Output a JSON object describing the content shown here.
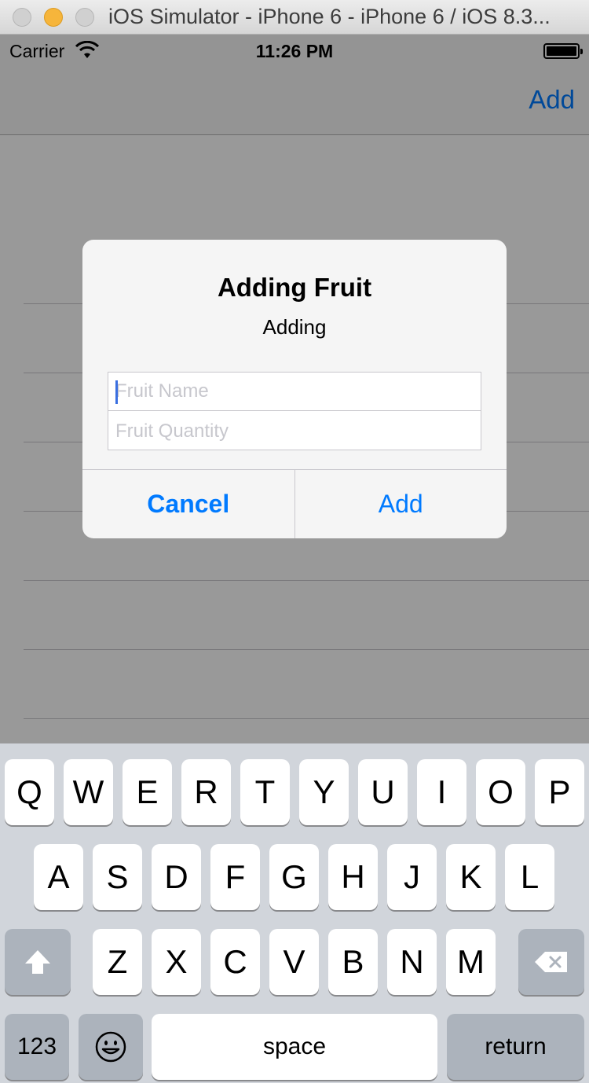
{
  "window": {
    "title": "iOS Simulator - iPhone 6 - iPhone 6 / iOS 8.3..."
  },
  "status_bar": {
    "carrier": "Carrier",
    "time": "11:26 PM",
    "wifi_icon": "wifi-icon",
    "battery_icon": "battery-icon"
  },
  "nav_bar": {
    "add_label": "Add"
  },
  "alert": {
    "title": "Adding Fruit",
    "message": "Adding",
    "fields": [
      {
        "placeholder": "Fruit Name",
        "value": ""
      },
      {
        "placeholder": "Fruit Quantity",
        "value": ""
      }
    ],
    "cancel_label": "Cancel",
    "add_label": "Add"
  },
  "keyboard": {
    "row1": [
      "Q",
      "W",
      "E",
      "R",
      "T",
      "Y",
      "U",
      "I",
      "O",
      "P"
    ],
    "row2": [
      "A",
      "S",
      "D",
      "F",
      "G",
      "H",
      "J",
      "K",
      "L"
    ],
    "row3": [
      "Z",
      "X",
      "C",
      "V",
      "B",
      "N",
      "M"
    ],
    "shift_icon": "shift-icon",
    "delete_icon": "delete-icon",
    "numbers_label": "123",
    "emoji_icon": "emoji-icon",
    "space_label": "space",
    "return_label": "return"
  },
  "colors": {
    "accent": "#007aff",
    "keyboard_bg": "#d1d5db",
    "function_key": "#acb3bc",
    "dim_overlay": "rgba(0,0,0,0.4)"
  }
}
